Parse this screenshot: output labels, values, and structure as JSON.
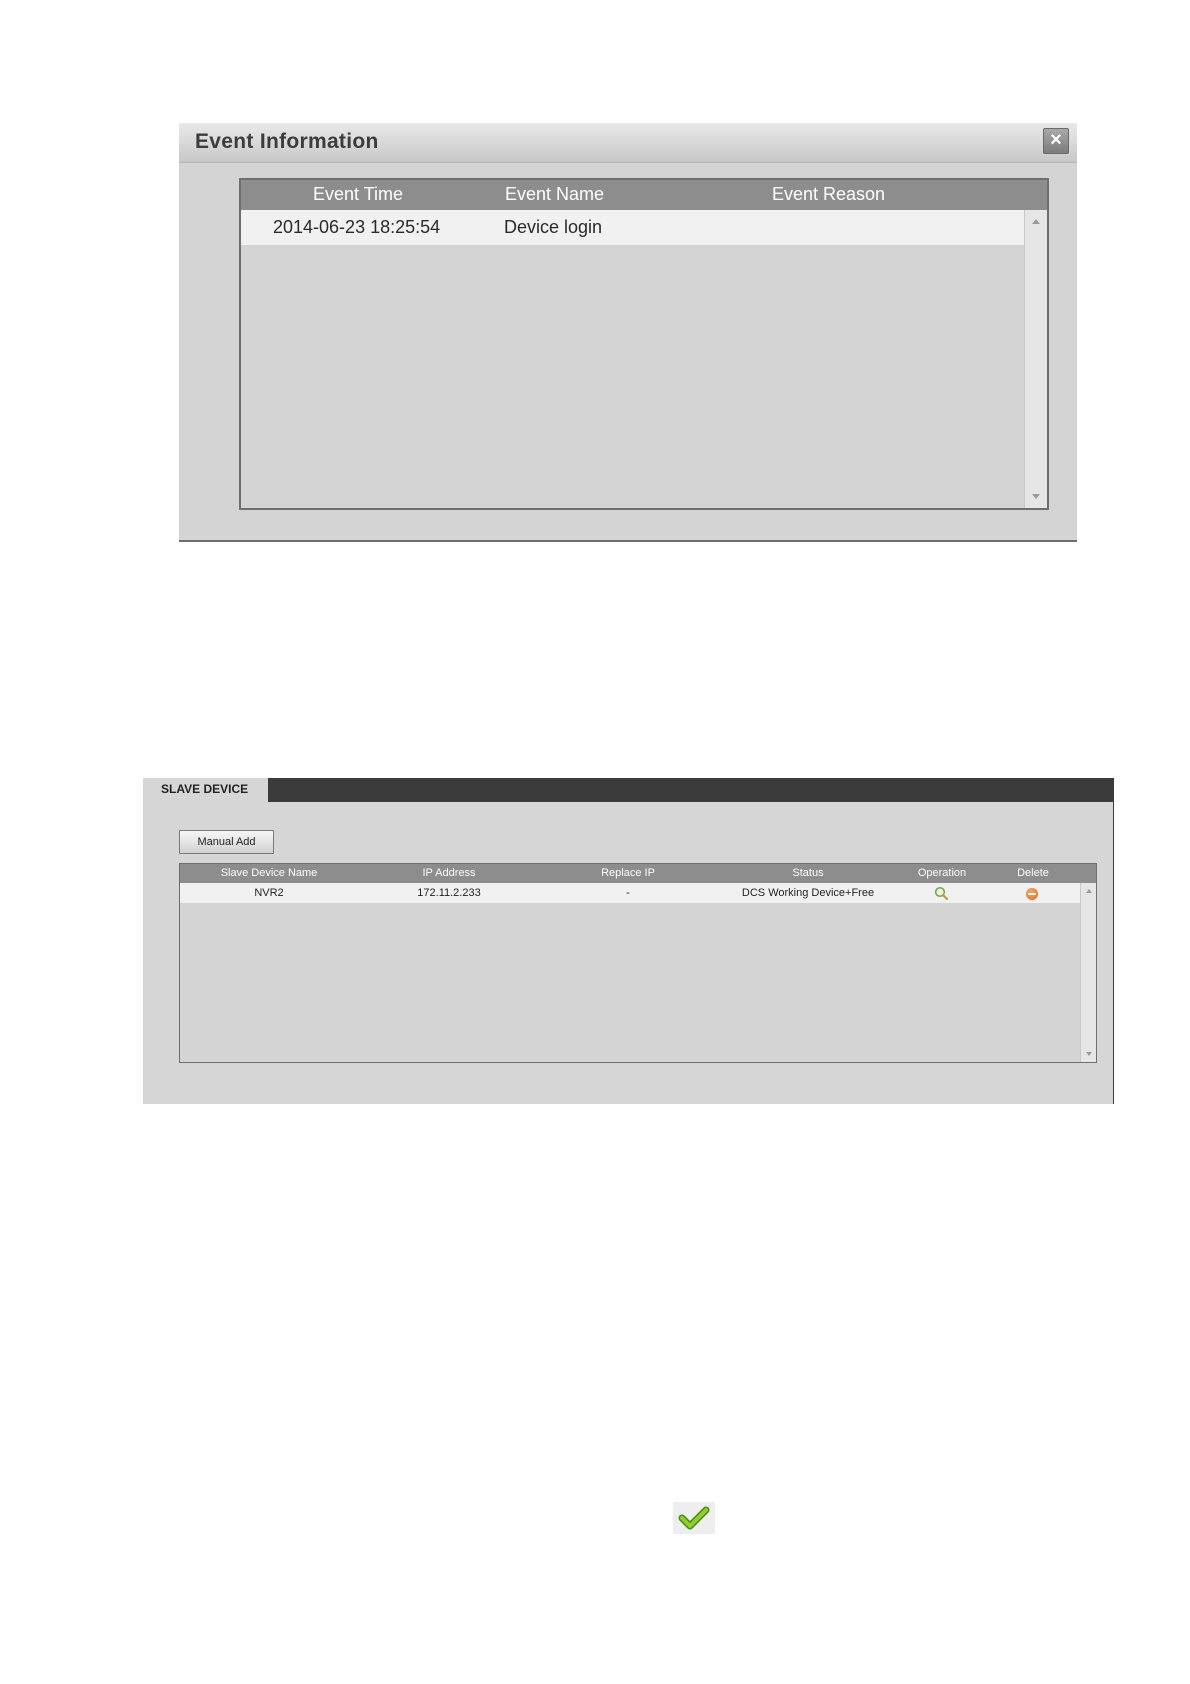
{
  "event_dialog": {
    "title": "Event Information",
    "close_icon": "close-icon",
    "columns": [
      "Event Time",
      "Event Name",
      "Event Reason"
    ],
    "rows": [
      {
        "event_time": "2014-06-23 18:25:54",
        "event_name": "Device login",
        "event_reason": ""
      }
    ]
  },
  "slave_device": {
    "tab_label": "SLAVE DEVICE",
    "manual_add_label": "Manual Add",
    "columns": [
      "Slave Device Name",
      "IP Address",
      "Replace IP",
      "Status",
      "Operation",
      "Delete"
    ],
    "rows": [
      {
        "name": "NVR2",
        "ip": "172.11.2.233",
        "replace_ip": "-",
        "status": "DCS Working Device+Free",
        "operation_icon": "search-icon",
        "delete_icon": "delete-icon"
      }
    ]
  },
  "check_icon": "checkmark-icon",
  "colors": {
    "header_gray": "#8d8d8d",
    "panel_gray": "#d4d4d4",
    "tab_bar": "#3b3b3b",
    "delete_orange": "#e06a18",
    "check_green": "#7cc21b"
  }
}
